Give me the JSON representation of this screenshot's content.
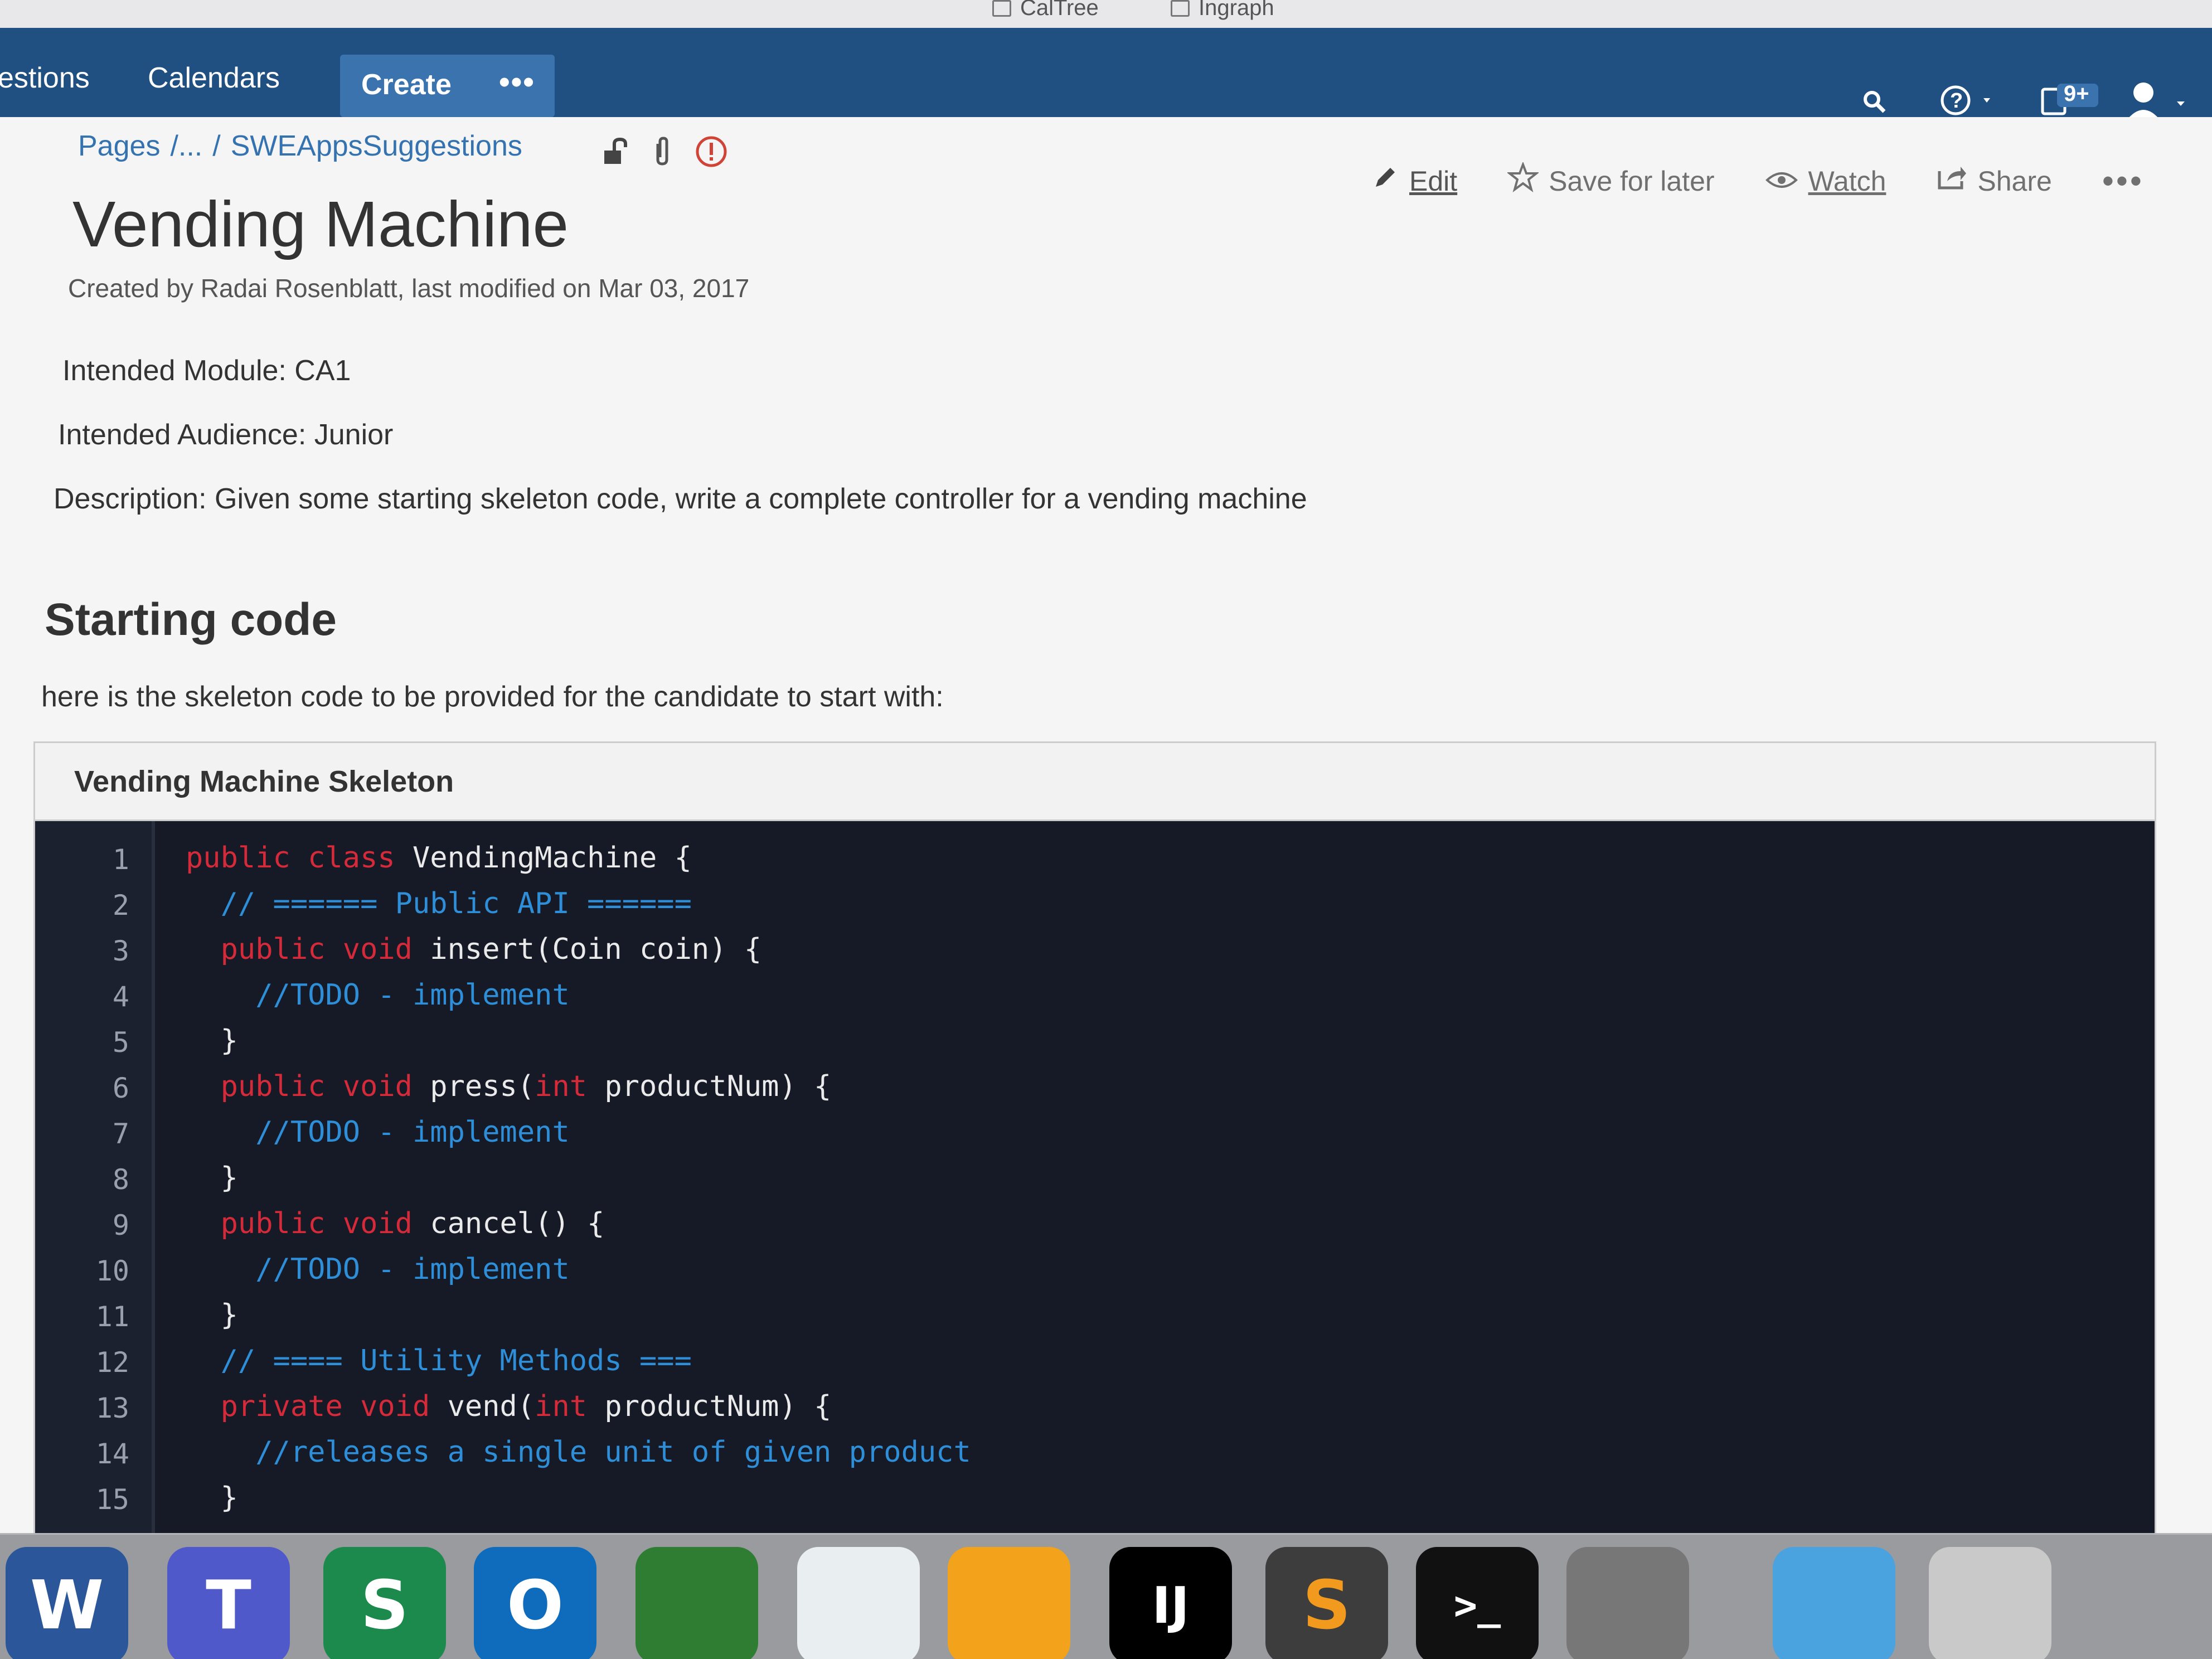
{
  "browser": {
    "bookmarks": [
      {
        "label": "CalTree"
      },
      {
        "label": "Ingraph"
      }
    ]
  },
  "topnav": {
    "links": [
      "estions",
      "Calendars"
    ],
    "create_label": "Create",
    "more_label": "•••",
    "badge_count": "9+"
  },
  "breadcrumb": {
    "root": "Pages",
    "ellipsis": "/...",
    "sep": "/",
    "current": "SWEAppsSuggestions"
  },
  "page": {
    "title": "Vending Machine",
    "byline": "Created by Radai Rosenblatt, last modified on Mar 03, 2017",
    "module": "Intended Module: CA1",
    "audience": "Intended Audience: Junior",
    "description": "Description: Given some starting skeleton code, write a complete controller for a vending machine",
    "section_heading": "Starting code",
    "section_intro": "here is the skeleton code to be provided for the candidate to start with:"
  },
  "actions": {
    "edit": "Edit",
    "save": "Save for later",
    "watch": "Watch",
    "share": "Share",
    "more": "•••"
  },
  "code_block": {
    "title": "Vending Machine Skeleton",
    "lines": [
      {
        "n": "1",
        "segments": [
          {
            "t": "public class ",
            "c": "kw"
          },
          {
            "t": "VendingMachine {",
            "c": "tx"
          }
        ]
      },
      {
        "n": "2",
        "segments": [
          {
            "t": "  // ====== Public API ======",
            "c": "cm"
          }
        ]
      },
      {
        "n": "3",
        "segments": [
          {
            "t": "  public void ",
            "c": "kw"
          },
          {
            "t": "insert(Coin coin) {",
            "c": "tx"
          }
        ]
      },
      {
        "n": "4",
        "segments": [
          {
            "t": "    //TODO - implement",
            "c": "cm"
          }
        ]
      },
      {
        "n": "5",
        "segments": [
          {
            "t": "  }",
            "c": "tx"
          }
        ]
      },
      {
        "n": "6",
        "segments": [
          {
            "t": "  public void ",
            "c": "kw"
          },
          {
            "t": "press(",
            "c": "tx"
          },
          {
            "t": "int ",
            "c": "kw"
          },
          {
            "t": "productNum) {",
            "c": "tx"
          }
        ]
      },
      {
        "n": "7",
        "segments": [
          {
            "t": "    //TODO - implement",
            "c": "cm"
          }
        ]
      },
      {
        "n": "8",
        "segments": [
          {
            "t": "  }",
            "c": "tx"
          }
        ]
      },
      {
        "n": "9",
        "segments": [
          {
            "t": "  public void ",
            "c": "kw"
          },
          {
            "t": "cancel() {",
            "c": "tx"
          }
        ]
      },
      {
        "n": "10",
        "segments": [
          {
            "t": "    //TODO - implement",
            "c": "cm"
          }
        ]
      },
      {
        "n": "11",
        "segments": [
          {
            "t": "  }",
            "c": "tx"
          }
        ]
      },
      {
        "n": "12",
        "segments": [
          {
            "t": "  // ==== Utility Methods ===",
            "c": "cm"
          }
        ]
      },
      {
        "n": "13",
        "segments": [
          {
            "t": "  private void ",
            "c": "kw"
          },
          {
            "t": "vend(",
            "c": "tx"
          },
          {
            "t": "int ",
            "c": "kw"
          },
          {
            "t": "productNum) {",
            "c": "tx"
          }
        ]
      },
      {
        "n": "14",
        "segments": [
          {
            "t": "    //releases a single unit of given product",
            "c": "cm"
          }
        ]
      },
      {
        "n": "15",
        "segments": [
          {
            "t": "  }",
            "c": "tx"
          }
        ]
      }
    ]
  },
  "dock": {
    "apps": [
      {
        "icon": "word-icon",
        "letter": "W",
        "color": "#2b579a"
      },
      {
        "icon": "teams-icon",
        "letter": "T",
        "color": "#5059c9"
      },
      {
        "icon": "skype-business-icon",
        "letter": "S",
        "color": "#1b8a4c"
      },
      {
        "icon": "outlook-icon",
        "letter": "O",
        "color": "#0f6cbd"
      },
      {
        "icon": "vpn-icon",
        "letter": "",
        "color": "#2e7d32"
      },
      {
        "icon": "wifi-app-icon",
        "letter": "",
        "color": "#e9eef0"
      },
      {
        "icon": "self-service-icon",
        "letter": "",
        "color": "#f2a31b"
      },
      {
        "icon": "intellij-icon",
        "letter": "IJ",
        "color": "#000000"
      },
      {
        "icon": "sublime-text-icon",
        "letter": "S",
        "color": "#3d3d3d"
      },
      {
        "icon": "terminal-icon",
        "letter": ">_",
        "color": "#111111"
      },
      {
        "icon": "system-preferences-icon",
        "letter": "",
        "color": "#777777"
      },
      {
        "icon": "downloads-folder-icon",
        "letter": "",
        "color": "#4aa3df"
      },
      {
        "icon": "trash-icon",
        "letter": "",
        "color": "#c9c9c9"
      }
    ]
  }
}
